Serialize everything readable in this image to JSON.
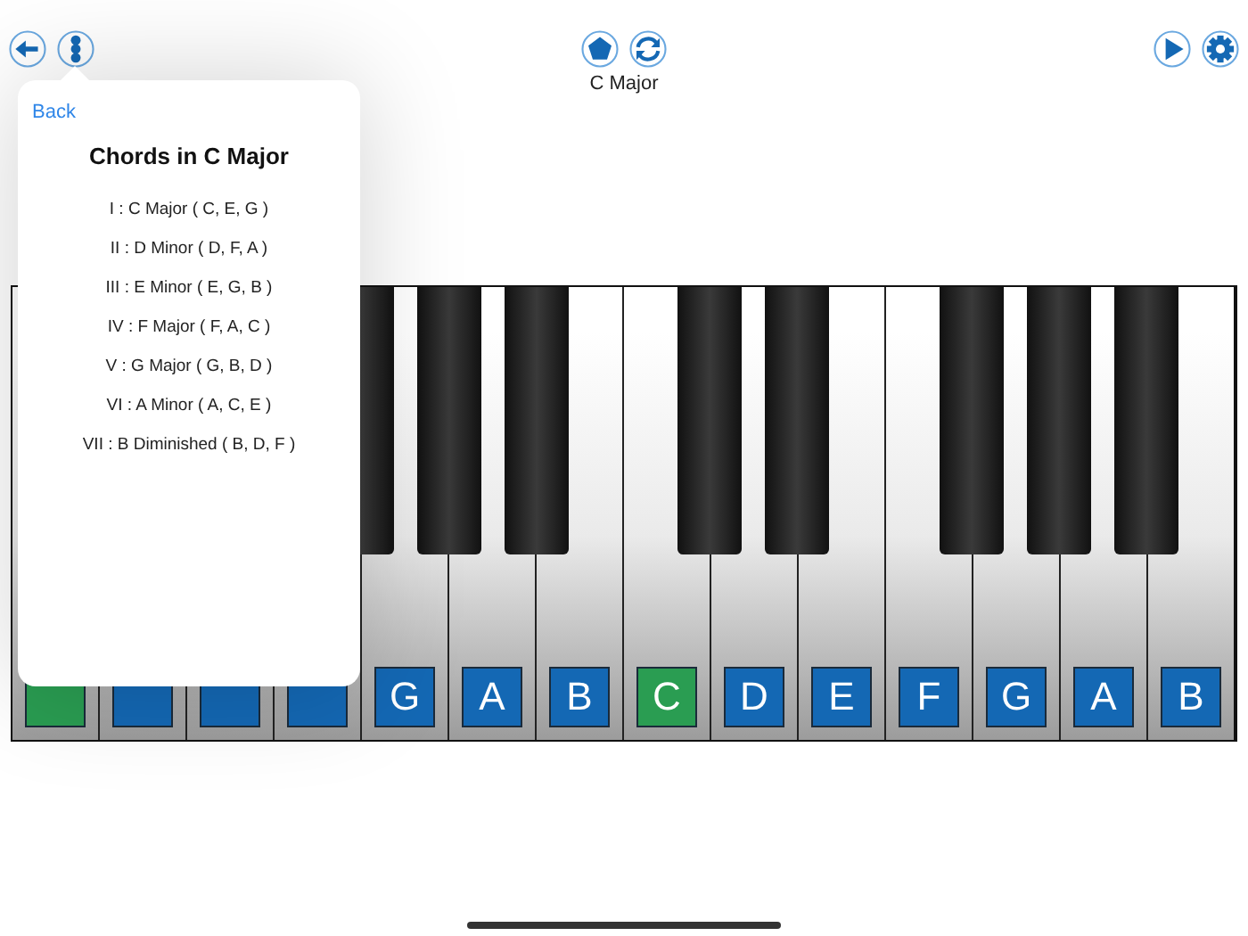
{
  "toolbar": {
    "left": [
      {
        "kind": "back"
      },
      {
        "kind": "menu"
      }
    ],
    "center": [
      {
        "kind": "shape"
      },
      {
        "kind": "refresh"
      }
    ],
    "scale_label": "C Major",
    "right": [
      {
        "kind": "play"
      },
      {
        "kind": "settings"
      }
    ]
  },
  "popup": {
    "back": "Back",
    "title": "Chords in C Major",
    "chords": [
      "I : C Major ( C, E, G )",
      "II : D Minor ( D, F, A )",
      "III : E Minor ( E, G, B )",
      "IV : F Major ( F, A, C )",
      "V : G Major ( G, B, D )",
      "VI : A Minor ( A, C, E )",
      "VII : B Diminished ( B, D, F )"
    ]
  },
  "keys": [
    {
      "color": "#2a9d52",
      "black_key_after": false
    },
    {
      "color": "#1468b4",
      "black_key_after": false
    },
    {
      "color": "#1468b4",
      "black_key_after": false
    },
    {
      "color": "#1468b4",
      "black_key_after": true
    },
    {
      "label": "G",
      "color": "#1468b4",
      "black_key_after": true
    },
    {
      "label": "A",
      "color": "#1468b4",
      "black_key_after": true
    },
    {
      "label": "B",
      "color": "#1468b4",
      "black_key_after": false
    },
    {
      "label": "C",
      "color": "#2a9d52",
      "black_key_after": true
    },
    {
      "label": "D",
      "color": "#1468b4",
      "black_key_after": true
    },
    {
      "label": "E",
      "color": "#1468b4",
      "black_key_after": false
    },
    {
      "label": "F",
      "color": "#1468b4",
      "black_key_after": true
    },
    {
      "label": "G",
      "color": "#1468b4",
      "black_key_after": true
    },
    {
      "label": "A",
      "color": "#1468b4",
      "black_key_after": true
    },
    {
      "label": "B",
      "color": "#1468b4",
      "black_key_after": false
    }
  ]
}
